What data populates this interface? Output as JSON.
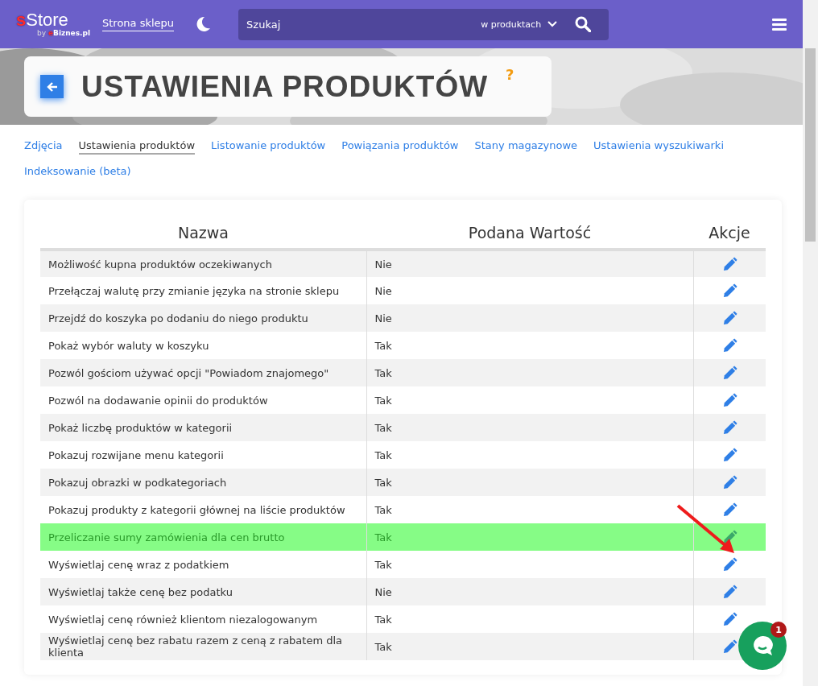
{
  "topbar": {
    "logo_prefix": "s",
    "logo_main": "Store",
    "logo_by": "by",
    "logo_brand_prefix": "e",
    "logo_brand": "Biznes.pl",
    "shop_link": "Strona sklepu",
    "search": {
      "placeholder": "Szukaj",
      "scope": "w produktach"
    }
  },
  "page_title": "USTAWIENIA PRODUKTÓW",
  "help": "?",
  "tabs": [
    {
      "label": "Zdjęcia",
      "selected": false
    },
    {
      "label": "Ustawienia produktów",
      "selected": true
    },
    {
      "label": "Listowanie produktów",
      "selected": false
    },
    {
      "label": "Powiązania produktów",
      "selected": false
    },
    {
      "label": "Stany magazynowe",
      "selected": false
    },
    {
      "label": "Ustawienia wyszukiwarki",
      "selected": false
    },
    {
      "label": "Indeksowanie (beta)",
      "selected": false
    }
  ],
  "table": {
    "columns": [
      "Nazwa",
      "Podana Wartość",
      "Akcje"
    ],
    "rows": [
      {
        "name": "Możliwość kupna produktów oczekiwanych",
        "value": "Nie",
        "highlighted": false
      },
      {
        "name": "Przełączaj walutę przy zmianie języka na stronie sklepu",
        "value": "Nie",
        "highlighted": false
      },
      {
        "name": "Przejdź do koszyka po dodaniu do niego produktu",
        "value": "Nie",
        "highlighted": false
      },
      {
        "name": "Pokaż wybór waluty w koszyku",
        "value": "Tak",
        "highlighted": false
      },
      {
        "name": "Pozwól gościom używać opcji \"Powiadom znajomego\"",
        "value": "Tak",
        "highlighted": false
      },
      {
        "name": "Pozwól na dodawanie opinii do produktów",
        "value": "Tak",
        "highlighted": false
      },
      {
        "name": "Pokaż liczbę produktów w kategorii",
        "value": "Tak",
        "highlighted": false
      },
      {
        "name": "Pokazuj rozwijane menu kategorii",
        "value": "Tak",
        "highlighted": false
      },
      {
        "name": "Pokazuj obrazki w podkategoriach",
        "value": "Tak",
        "highlighted": false
      },
      {
        "name": "Pokazuj produkty z kategorii głównej na liście produktów",
        "value": "Tak",
        "highlighted": false
      },
      {
        "name": "Przeliczanie sumy zamówienia dla cen brutto",
        "value": "Tak",
        "highlighted": true
      },
      {
        "name": "Wyświetlaj cenę wraz z podatkiem",
        "value": "Tak",
        "highlighted": false
      },
      {
        "name": "Wyświetlaj także cenę bez podatku",
        "value": "Nie",
        "highlighted": false
      },
      {
        "name": "Wyświetlaj cenę również klientom niezalogowanym",
        "value": "Tak",
        "highlighted": false
      },
      {
        "name": "Wyświetlaj cenę bez rabatu razem z ceną z rabatem dla klienta",
        "value": "Tak",
        "highlighted": false
      }
    ]
  },
  "chat_badge": "1"
}
